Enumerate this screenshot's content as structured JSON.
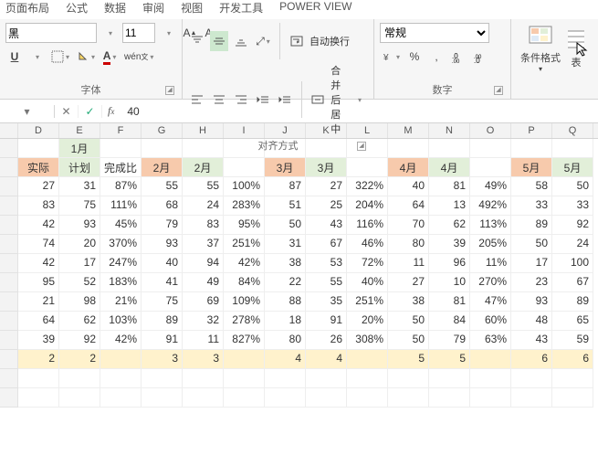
{
  "tabs": [
    "页面布局",
    "公式",
    "数据",
    "审阅",
    "视图",
    "开发工具",
    "POWER VIEW"
  ],
  "font": {
    "name": "黑",
    "size": "11",
    "group_label": "字体"
  },
  "align": {
    "wrap": "自动换行",
    "merge": "合并后居中",
    "group_label": "对齐方式"
  },
  "number": {
    "format": "常规",
    "pct": "%",
    "comma": ",",
    "group_label": "数字"
  },
  "cf": {
    "label": "条件格式",
    "table_label": "表"
  },
  "formula_bar": {
    "value": "40"
  },
  "cols": [
    "D",
    "E",
    "F",
    "G",
    "H",
    "I",
    "J",
    "K",
    "L",
    "M",
    "N",
    "O",
    "P",
    "Q"
  ],
  "month_row": {
    "jan": "1月"
  },
  "subheaders": {
    "actual": "实际",
    "plan": "计划",
    "ratio": "完成比",
    "m2": "2月",
    "m3": "3月",
    "m4": "4月",
    "m5": "5月"
  },
  "rows": [
    {
      "d": "27",
      "e": "31",
      "f": "87%",
      "g": "55",
      "h": "55",
      "i": "100%",
      "j": "87",
      "k": "27",
      "l": "322%",
      "m": "40",
      "n": "81",
      "o": "49%",
      "p": "58",
      "q": "50"
    },
    {
      "d": "83",
      "e": "75",
      "f": "111%",
      "g": "68",
      "h": "24",
      "i": "283%",
      "j": "51",
      "k": "25",
      "l": "204%",
      "m": "64",
      "n": "13",
      "o": "492%",
      "p": "33",
      "q": "33"
    },
    {
      "d": "42",
      "e": "93",
      "f": "45%",
      "g": "79",
      "h": "83",
      "i": "95%",
      "j": "50",
      "k": "43",
      "l": "116%",
      "m": "70",
      "n": "62",
      "o": "113%",
      "p": "89",
      "q": "92"
    },
    {
      "d": "74",
      "e": "20",
      "f": "370%",
      "g": "93",
      "h": "37",
      "i": "251%",
      "j": "31",
      "k": "67",
      "l": "46%",
      "m": "80",
      "n": "39",
      "o": "205%",
      "p": "50",
      "q": "24"
    },
    {
      "d": "42",
      "e": "17",
      "f": "247%",
      "g": "40",
      "h": "94",
      "i": "42%",
      "j": "38",
      "k": "53",
      "l": "72%",
      "m": "11",
      "n": "96",
      "o": "11%",
      "p": "17",
      "q": "100"
    },
    {
      "d": "95",
      "e": "52",
      "f": "183%",
      "g": "41",
      "h": "49",
      "i": "84%",
      "j": "22",
      "k": "55",
      "l": "40%",
      "m": "27",
      "n": "10",
      "o": "270%",
      "p": "23",
      "q": "67"
    },
    {
      "d": "21",
      "e": "98",
      "f": "21%",
      "g": "75",
      "h": "69",
      "i": "109%",
      "j": "88",
      "k": "35",
      "l": "251%",
      "m": "38",
      "n": "81",
      "o": "47%",
      "p": "93",
      "q": "89"
    },
    {
      "d": "64",
      "e": "62",
      "f": "103%",
      "g": "89",
      "h": "32",
      "i": "278%",
      "j": "18",
      "k": "91",
      "l": "20%",
      "m": "50",
      "n": "84",
      "o": "60%",
      "p": "48",
      "q": "65"
    },
    {
      "d": "39",
      "e": "92",
      "f": "42%",
      "g": "91",
      "h": "11",
      "i": "827%",
      "j": "80",
      "k": "26",
      "l": "308%",
      "m": "50",
      "n": "79",
      "o": "63%",
      "p": "43",
      "q": "59"
    }
  ],
  "totals": {
    "d": "2",
    "e": "2",
    "f": "",
    "g": "3",
    "h": "3",
    "i": "",
    "j": "4",
    "k": "4",
    "l": "",
    "m": "5",
    "n": "5",
    "o": "",
    "p": "6",
    "q": "6"
  }
}
